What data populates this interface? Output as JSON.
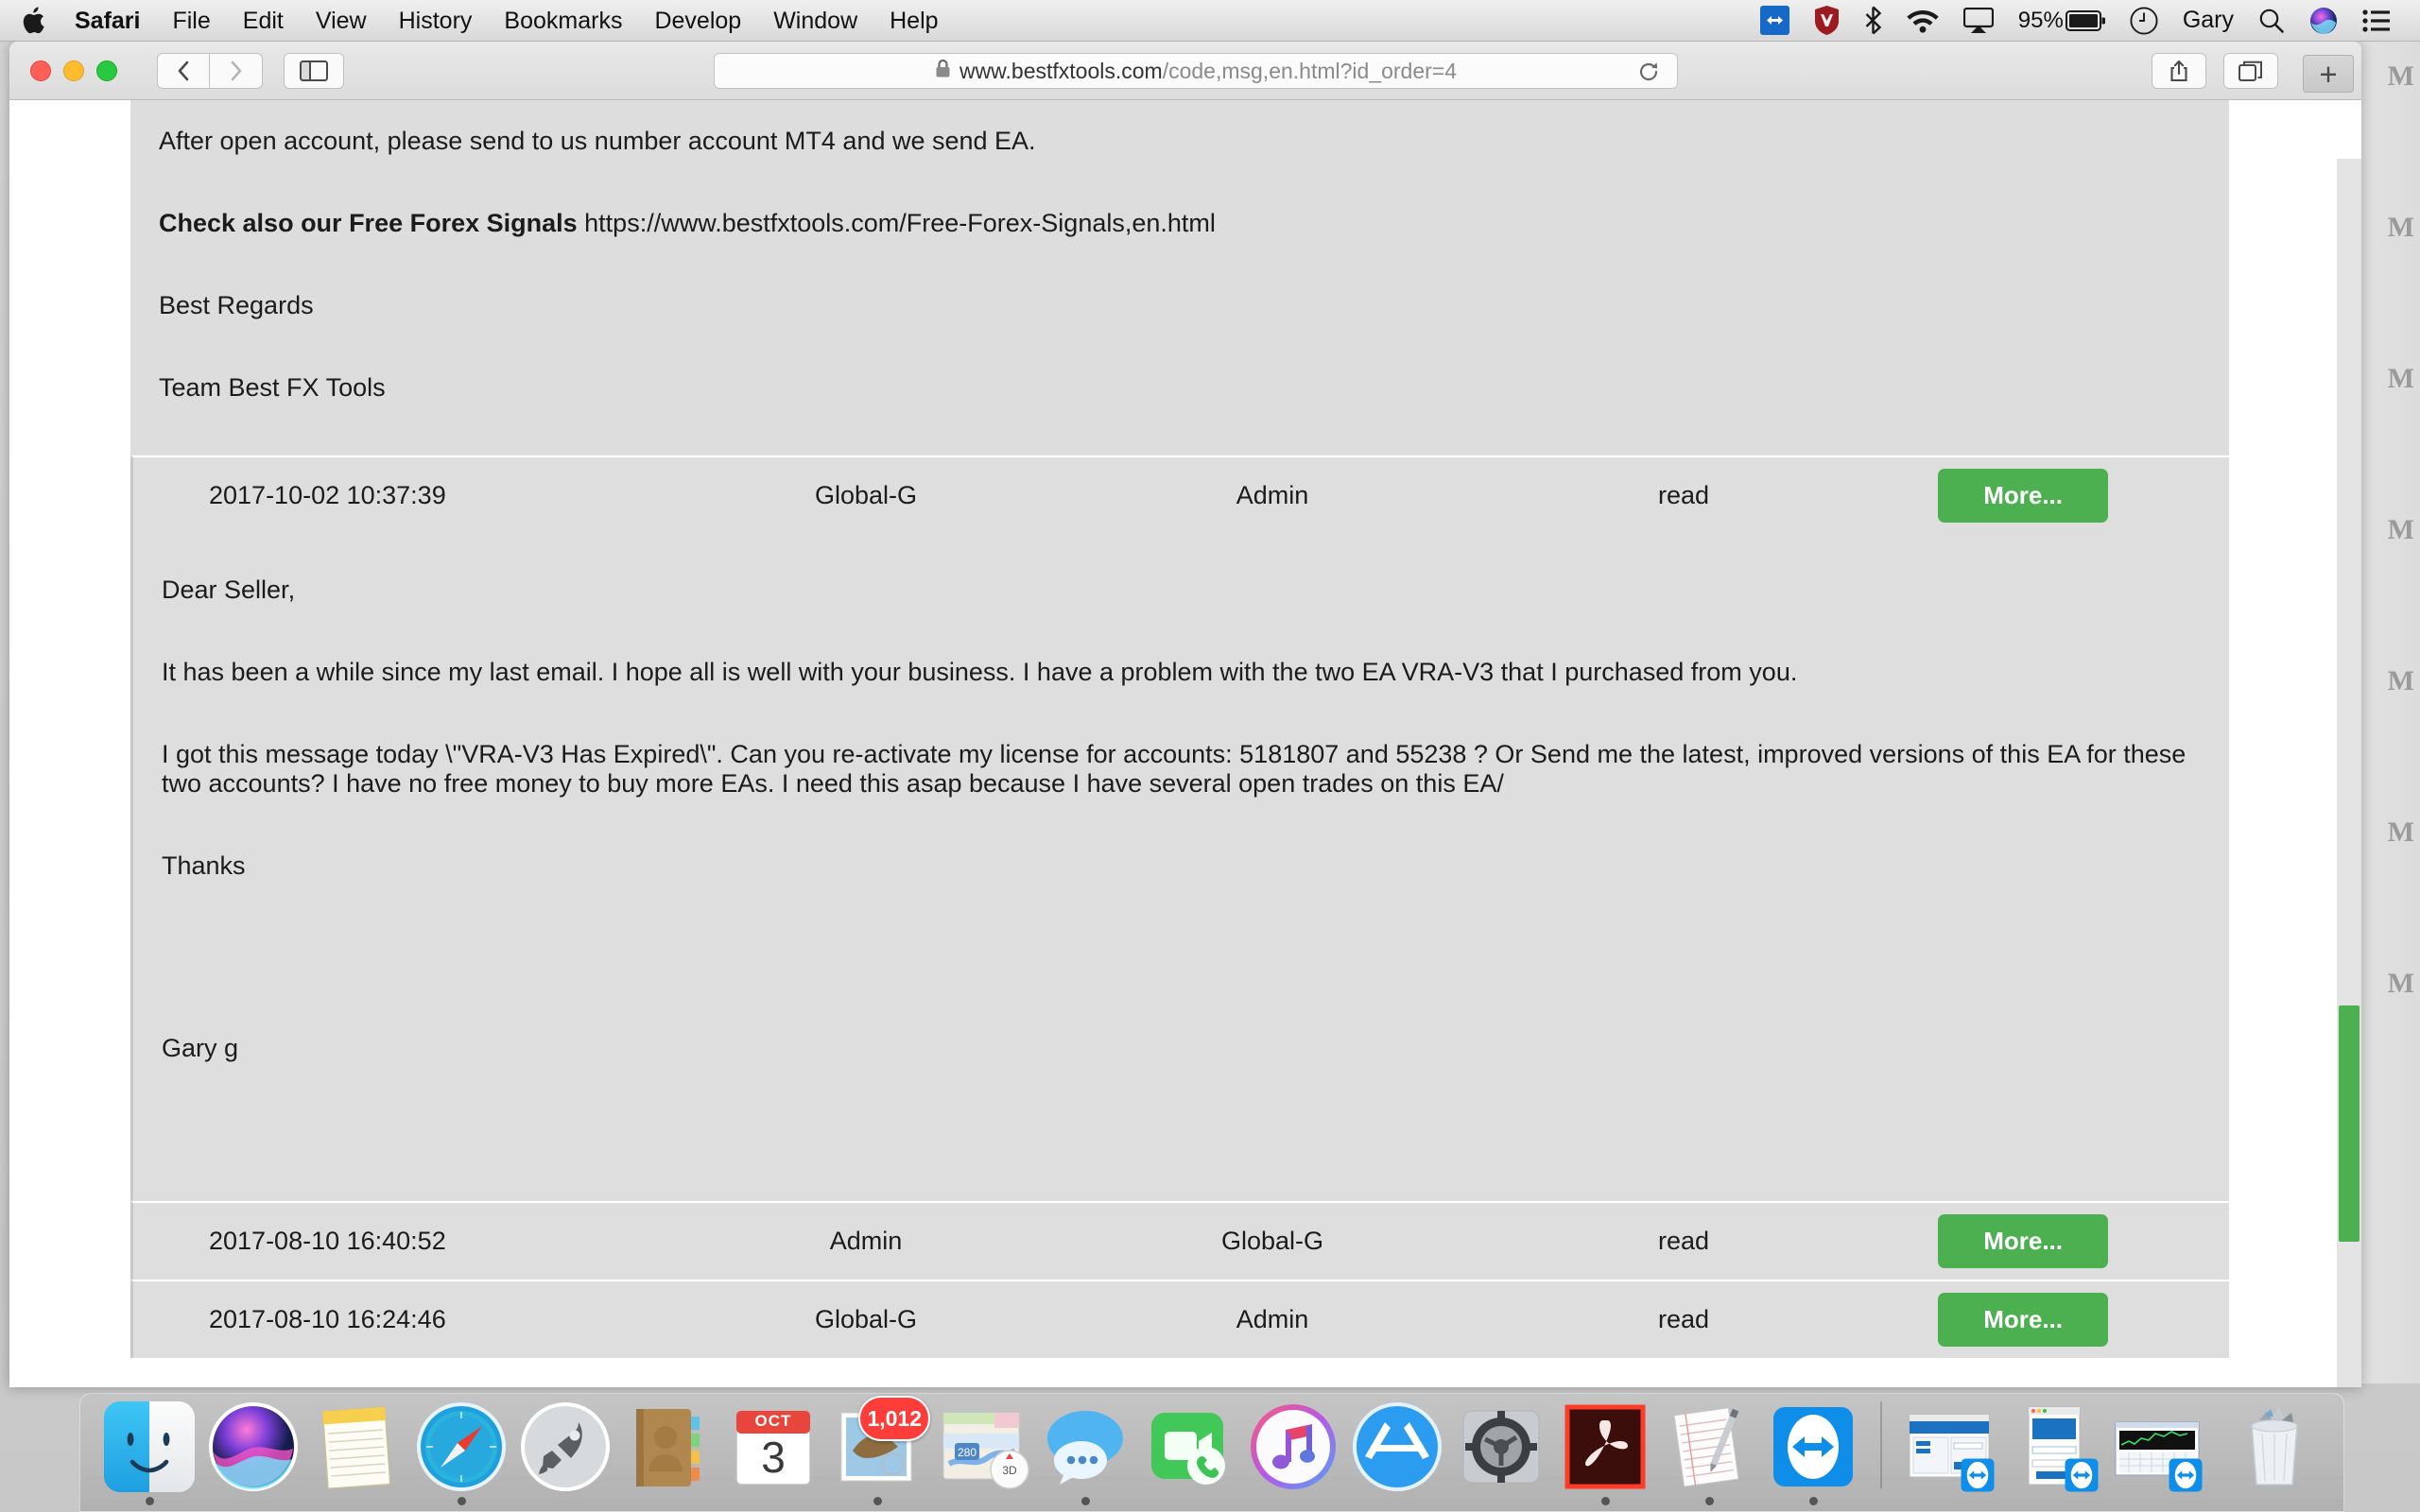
{
  "menubar": {
    "apple_icon": "apple-logo",
    "items": [
      {
        "label": "Safari",
        "bold": true
      },
      {
        "label": "File",
        "bold": false
      },
      {
        "label": "Edit",
        "bold": false
      },
      {
        "label": "View",
        "bold": false
      },
      {
        "label": "History",
        "bold": false
      },
      {
        "label": "Bookmarks",
        "bold": false
      },
      {
        "label": "Develop",
        "bold": false
      },
      {
        "label": "Window",
        "bold": false
      },
      {
        "label": "Help",
        "bold": false
      }
    ],
    "status": {
      "teamviewer_icon": "teamviewer-icon",
      "shield_icon": "shield-icon",
      "bluetooth_icon": "bluetooth-icon",
      "wifi_icon": "wifi-icon",
      "airplay_icon": "airplay-icon",
      "battery_percent": "95%",
      "battery_icon": "battery-icon",
      "timemachine_icon": "time-machine-icon",
      "user_name": "Gary",
      "search_icon": "search-icon",
      "siri_icon": "siri-icon",
      "notification_icon": "notification-center-icon"
    }
  },
  "browser": {
    "window_controls": {
      "close": "close",
      "minimize": "minimize",
      "zoom": "zoom"
    },
    "back_icon": "chevron-left-icon",
    "forward_icon": "chevron-right-icon",
    "sidebar_icon": "sidebar-icon",
    "lock_icon": "lock-icon",
    "url_domain": "www.bestfxtools.com",
    "url_path": "/code,msg,en.html?id_order=4",
    "reload_icon": "reload-icon",
    "share_icon": "share-icon",
    "tabs_icon": "show-all-tabs-icon",
    "new_tab_label": "+"
  },
  "page": {
    "top_paragraphs": [
      {
        "text": "After open account, please send to us number account MT4 and we send EA.",
        "bold_prefix": ""
      },
      {
        "bold_prefix": "Check also our Free Forex Signals",
        "text": " https://www.bestfxtools.com/Free-Forex-Signals,en.html"
      },
      {
        "text": "Best Regards",
        "bold_prefix": ""
      },
      {
        "text": "Team Best FX Tools",
        "bold_prefix": ""
      }
    ],
    "rows": [
      {
        "date": "2017-10-02 10:37:39",
        "from": "Global-G",
        "to": "Admin",
        "status": "read",
        "button": "More..."
      },
      {
        "date": "2017-08-10 16:40:52",
        "from": "Admin",
        "to": "Global-G",
        "status": "read",
        "button": "More..."
      },
      {
        "date": "2017-08-10 16:24:46",
        "from": "Global-G",
        "to": "Admin",
        "status": "read",
        "button": "More..."
      }
    ],
    "message_body": {
      "greeting": "Dear Seller,",
      "paragraph1": "It has been a while since my last email.  I hope all is well with your business. I have a problem with the two EA VRA-V3 that I purchased from you.",
      "paragraph2": "I got this message today \\\"VRA-V3 Has Expired\\\".  Can you re-activate my license for accounts: 5181807 and 55238 ?  Or Send me the latest, improved versions of this EA for these two accounts?  I have no free money to buy more EAs. I need this asap because I have several open trades on this EA/",
      "thanks": "Thanks",
      "signature": "Gary g"
    },
    "scrollbar_color": "#4cb050"
  },
  "dock": {
    "items": [
      {
        "name": "finder",
        "label": "Finder",
        "running": true
      },
      {
        "name": "siri",
        "label": "Siri",
        "running": false
      },
      {
        "name": "notes",
        "label": "Notes",
        "running": false
      },
      {
        "name": "safari",
        "label": "Safari",
        "running": true
      },
      {
        "name": "launchpad",
        "label": "Launchpad",
        "running": false
      },
      {
        "name": "contacts",
        "label": "Contacts",
        "running": false
      },
      {
        "name": "calendar",
        "label": "Calendar",
        "running": false,
        "month": "OCT",
        "day": "3"
      },
      {
        "name": "mail",
        "label": "Mail",
        "running": true,
        "badge": "1,012"
      },
      {
        "name": "maps",
        "label": "Maps",
        "running": false,
        "route": "280",
        "mode": "3D"
      },
      {
        "name": "messages",
        "label": "Messages",
        "running": true
      },
      {
        "name": "facetime",
        "label": "FaceTime",
        "running": false
      },
      {
        "name": "itunes",
        "label": "iTunes",
        "running": false
      },
      {
        "name": "appstore",
        "label": "App Store",
        "running": false
      },
      {
        "name": "system-preferences",
        "label": "System Preferences",
        "running": false
      },
      {
        "name": "adobe-acrobat",
        "label": "Adobe Acrobat Reader",
        "running": true
      },
      {
        "name": "textedit",
        "label": "TextEdit",
        "running": true
      },
      {
        "name": "teamviewer",
        "label": "TeamViewer",
        "running": true
      }
    ],
    "minimized": [
      {
        "name": "teamviewer-remote-control-window",
        "label": "TeamViewer Remote Control"
      },
      {
        "name": "teamviewer-signin-window",
        "label": "Computers & Contacts"
      },
      {
        "name": "metatrader-chart-window",
        "label": "MetaTrader Chart"
      }
    ],
    "trash": {
      "name": "trash",
      "label": "Trash"
    }
  }
}
